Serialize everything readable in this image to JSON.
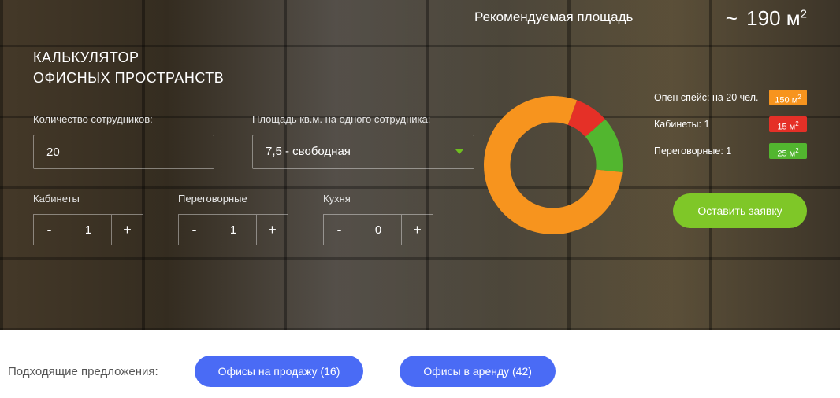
{
  "title_line1": "КАЛЬКУЛЯТОР",
  "title_line2": "ОФИСНЫХ ПРОСТРАНСТВ",
  "fields": {
    "employees_label": "Количество сотрудников:",
    "employees_value": "20",
    "area_per_label": "Площадь кв.м. на одного сотрудника:",
    "area_per_value": "7,5 - свободная"
  },
  "steppers": {
    "cabinets": {
      "label": "Кабинеты",
      "value": "1"
    },
    "meeting": {
      "label": "Переговорные",
      "value": "1"
    },
    "kitchen": {
      "label": "Кухня",
      "value": "0"
    }
  },
  "recommend_title": "Рекомендуемая площадь",
  "area_total_prefix": "~ ",
  "area_total_value": "190",
  "area_total_unit": "м",
  "area_total_sup": "2",
  "legend": [
    {
      "label": "Опен спейс: на 20 чел.",
      "value": "150 м",
      "sup": "2",
      "color": "b-orange"
    },
    {
      "label": "Кабинеты: 1",
      "value": "15 м",
      "sup": "2",
      "color": "b-red"
    },
    {
      "label": "Переговорные: 1",
      "value": "25 м",
      "sup": "2",
      "color": "b-green"
    }
  ],
  "cta_label": "Оставить заявку",
  "offers_label": "Подходящие предложения:",
  "offers": [
    {
      "label": "Офисы на продажу (16)"
    },
    {
      "label": "Офисы в аренду (42)"
    }
  ],
  "chart_data": {
    "type": "pie",
    "title": "Рекомендуемая площадь",
    "series": [
      {
        "name": "Опен спейс",
        "value": 150,
        "color": "#f7941e"
      },
      {
        "name": "Кабинеты",
        "value": 15,
        "color": "#e53027"
      },
      {
        "name": "Переговорные",
        "value": 25,
        "color": "#52b62f"
      }
    ],
    "total": 190,
    "unit": "м²",
    "donut_inner_ratio": 0.62
  }
}
